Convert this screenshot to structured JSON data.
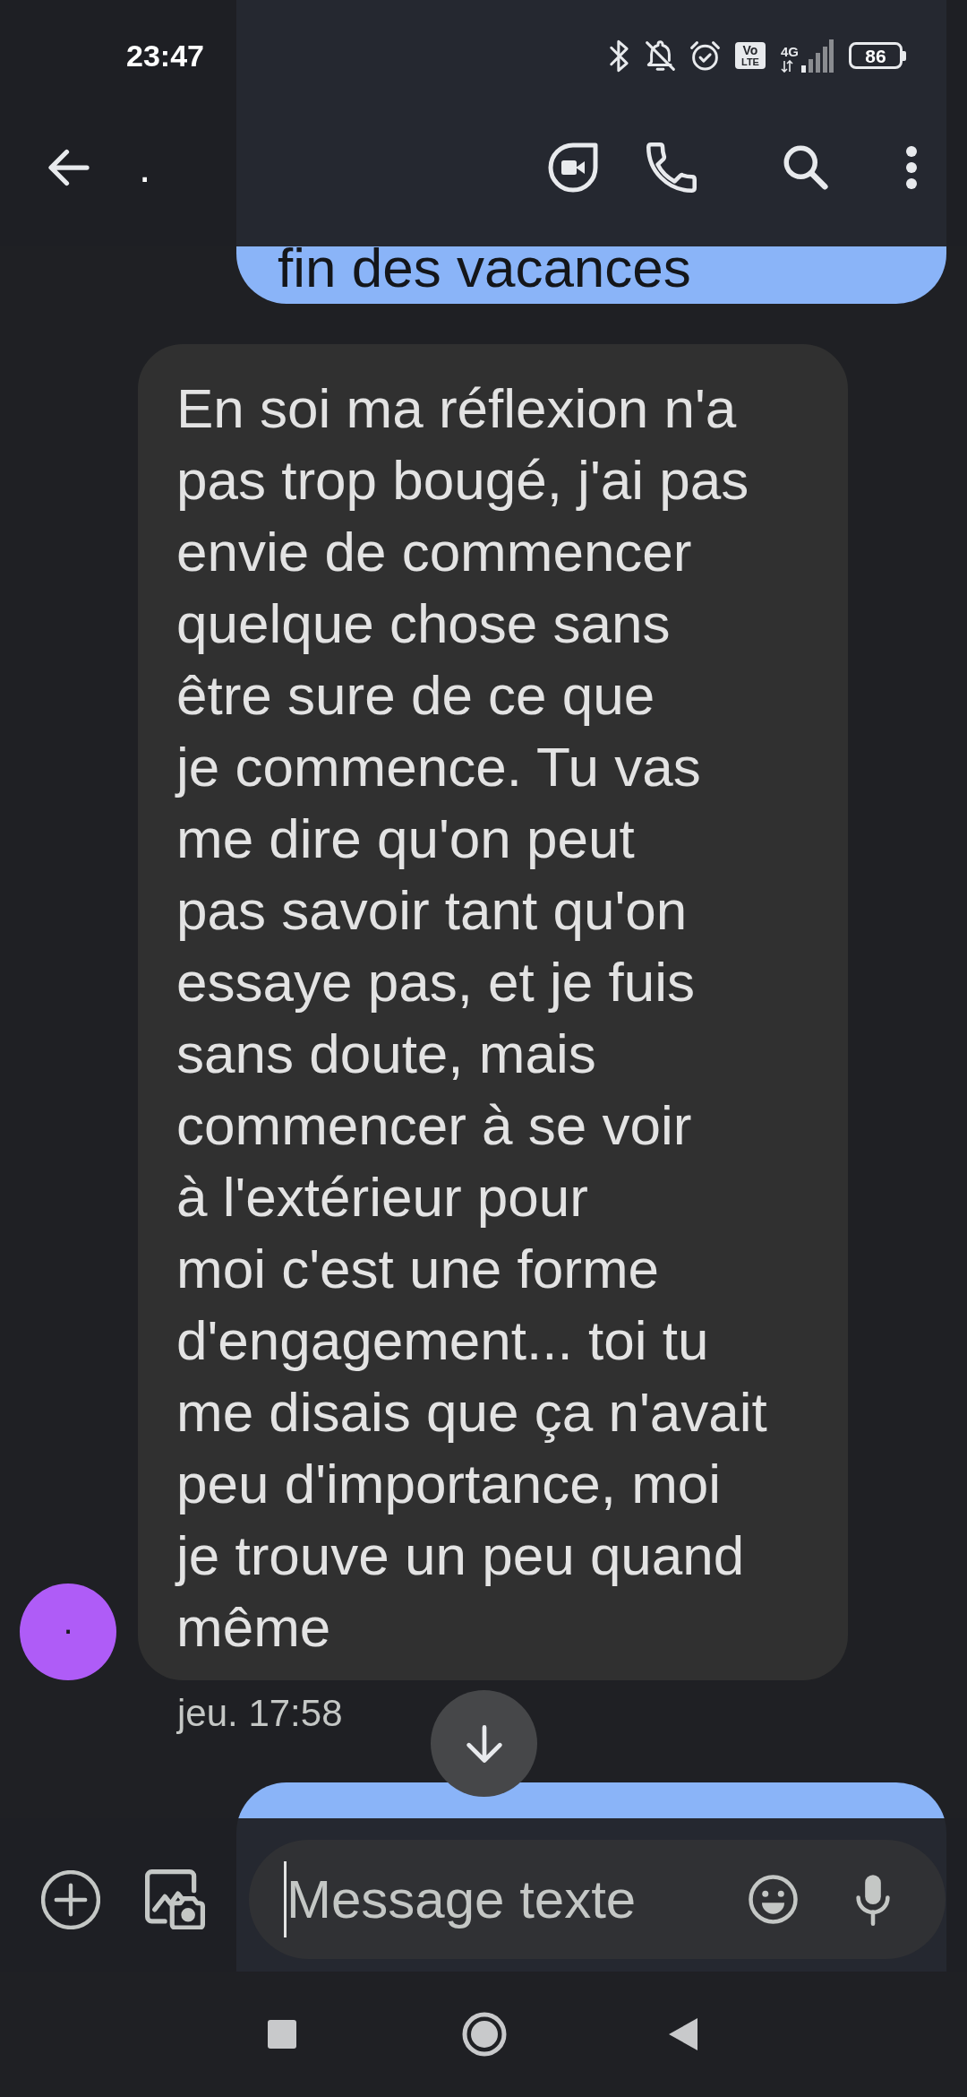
{
  "status_bar": {
    "time": "23:47",
    "volte": [
      "Vo",
      "LTE"
    ],
    "network": "4G",
    "battery": "86"
  },
  "app_bar": {
    "title": "."
  },
  "messages": [
    {
      "kind": "sent",
      "text": "fin des vacances"
    },
    {
      "kind": "received",
      "avatar": ".",
      "text": "En soi ma réflexion n'a\npas trop bougé, j'ai pas\nenvie de commencer\nquelque chose sans\nêtre sure de ce que\nje commence. Tu vas\nme dire qu'on peut\npas savoir tant qu'on\nessaye pas, et je fuis\nsans doute, mais\ncommencer à se voir\nà l'extérieur pour\nmoi c'est une forme\nd'engagement... toi tu\nme disais que ça n'avait\npeu d'importance, moi\nje trouve un peu quand\nmême",
      "time": "jeu. 17:58"
    },
    {
      "kind": "sent"
    }
  ],
  "compose": {
    "placeholder": "Message texte",
    "focused": true
  }
}
